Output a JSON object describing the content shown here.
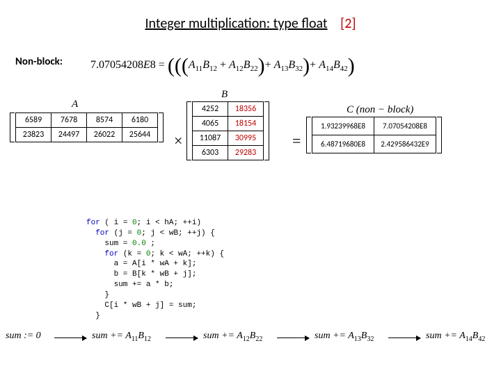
{
  "title": "Integer multiplication: type float",
  "ref": "[2]",
  "nonblock_label": "Non-block:",
  "formula": "7.07054208E8 = (((A₁₁B₁₂ + A₁₂B₂₂) + A₁₃B₃₂) + A₁₄B₄₂)",
  "labels": {
    "A": "A",
    "B": "B",
    "C": "C (non − block)"
  },
  "ops": {
    "times": "×",
    "equals": "="
  },
  "chart_data": [
    {
      "type": "table",
      "name": "A",
      "rows": [
        [
          6589,
          7678,
          8574,
          6180
        ],
        [
          23823,
          24497,
          26022,
          25644
        ]
      ]
    },
    {
      "type": "table",
      "name": "B",
      "rows": [
        [
          4252,
          18356
        ],
        [
          4065,
          18154
        ],
        [
          11087,
          30995
        ],
        [
          6303,
          29283
        ]
      ]
    },
    {
      "type": "table",
      "name": "C_nonblock",
      "rows": [
        [
          "1.93239968E8",
          "7.07054208E8"
        ],
        [
          "6.48719680E8",
          "2.429586432E9"
        ]
      ]
    }
  ],
  "code_lines": [
    {
      "pre": "",
      "kw": "for",
      "rest": " ( i = ",
      "n": "0",
      "rest2": "; i < hA; ++i)"
    },
    {
      "pre": "  ",
      "kw": "for",
      "rest": " (j = ",
      "n": "0",
      "rest2": "; j < wB; ++j) {"
    },
    {
      "pre": "    ",
      "plain": "sum = ",
      "n": "0.0",
      "rest2": " ;"
    },
    {
      "pre": "    ",
      "kw": "for",
      "rest": " (k = ",
      "n": "0",
      "rest2": "; k < wA; ++k) {"
    },
    {
      "pre": "      ",
      "plain": "a = A[i * wA + k];"
    },
    {
      "pre": "      ",
      "plain": "b = B[k * wB + j];"
    },
    {
      "pre": "      ",
      "plain": "sum += a * b;"
    },
    {
      "pre": "    ",
      "plain": "}"
    },
    {
      "pre": "    ",
      "plain": "C[i * wB + j] = sum;"
    },
    {
      "pre": "  ",
      "plain": "}"
    }
  ],
  "sums": [
    {
      "text": "sum := 0"
    },
    {
      "text": "sum += A₁₁B₁₂"
    },
    {
      "text": "sum += A₁₂B₂₂"
    },
    {
      "text": "sum += A₁₃B₃₂"
    },
    {
      "text": "sum += A₁₄B₄₂"
    }
  ]
}
